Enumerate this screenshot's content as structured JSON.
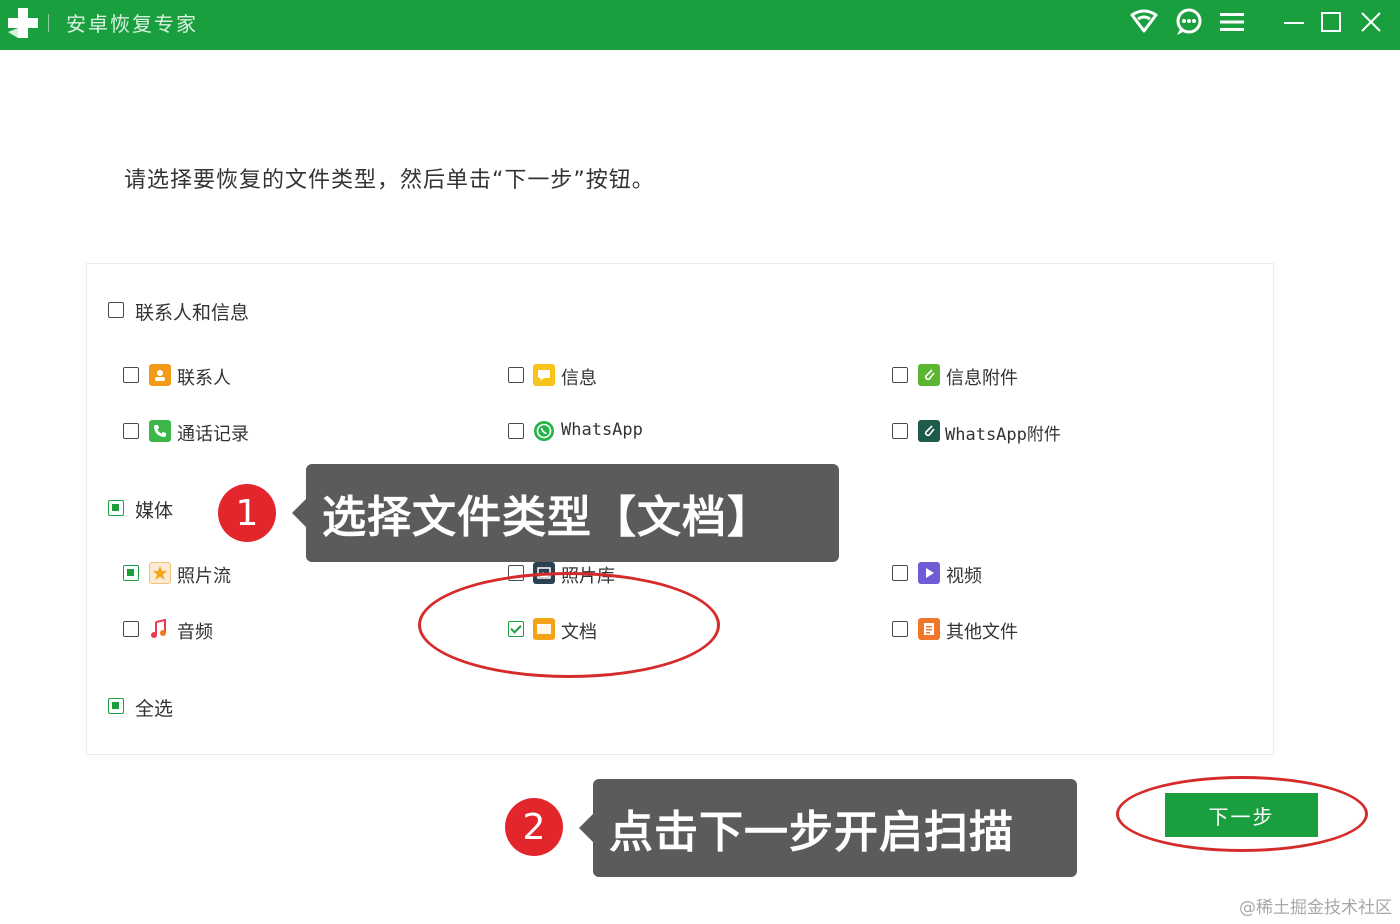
{
  "window": {
    "title": "安卓恢复专家",
    "accent": "#1a9f3e",
    "controls": [
      "wifi-icon",
      "chat-icon",
      "menu-icon",
      "minimize-icon",
      "maximize-icon",
      "close-icon"
    ]
  },
  "instruction": "请选择要恢复的文件类型，然后单击“下一步”按钮。",
  "groups": {
    "contacts_messages": {
      "label": "联系人和信息",
      "state": "unchecked",
      "items": [
        {
          "label": "联系人",
          "icon": "contacts-icon",
          "checked": false
        },
        {
          "label": "信息",
          "icon": "message-icon",
          "checked": false
        },
        {
          "label": "信息附件",
          "icon": "attachment-icon",
          "checked": false
        },
        {
          "label": "通话记录",
          "icon": "phone-icon",
          "checked": false
        },
        {
          "label": "WhatsApp",
          "icon": "whatsapp-icon",
          "checked": false
        },
        {
          "label": "WhatsApp附件",
          "icon": "whatsapp-attachment-icon",
          "checked": false
        }
      ]
    },
    "media": {
      "label": "媒体",
      "state": "partial",
      "items": [
        {
          "label": "照片流",
          "icon": "photostream-icon",
          "checked": "partial"
        },
        {
          "label": "照片库",
          "icon": "photo-library-icon",
          "checked": false
        },
        {
          "label": "视频",
          "icon": "video-icon",
          "checked": false
        },
        {
          "label": "音频",
          "icon": "audio-icon",
          "checked": false
        },
        {
          "label": "文档",
          "icon": "folder-icon",
          "checked": true
        },
        {
          "label": "其他文件",
          "icon": "file-icon",
          "checked": false
        }
      ]
    },
    "select_all": {
      "label": "全选",
      "state": "partial"
    }
  },
  "next_button": "下一步",
  "annotations": {
    "step1": {
      "number": "1",
      "text": "选择文件类型【文档】"
    },
    "step2": {
      "number": "2",
      "text": "点击下一步开启扫描"
    },
    "highlight_color": "#d62b2b"
  },
  "watermark": "@稀土掘金技术社区"
}
